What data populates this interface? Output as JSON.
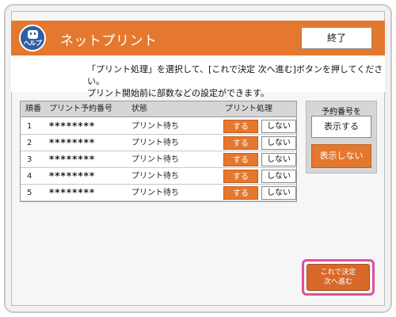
{
  "header": {
    "title": "ネットプリント",
    "help_label": "ヘルプ",
    "end_label": "終了"
  },
  "instructions": {
    "line1": "「プリント処理」を選択して、[これで決定 次へ進む]ボタンを押してください。",
    "line2": "プリント開始前に部数などの設定ができます。"
  },
  "table": {
    "headers": {
      "order": "順番",
      "reservation": "プリント予約番号",
      "status": "状態",
      "process": "プリント処理"
    },
    "rows": [
      {
        "order": "1",
        "reservation": "********",
        "status": "プリント待ち",
        "do": "する",
        "dont": "しない"
      },
      {
        "order": "2",
        "reservation": "********",
        "status": "プリント待ち",
        "do": "する",
        "dont": "しない"
      },
      {
        "order": "3",
        "reservation": "********",
        "status": "プリント待ち",
        "do": "する",
        "dont": "しない"
      },
      {
        "order": "4",
        "reservation": "********",
        "status": "プリント待ち",
        "do": "する",
        "dont": "しない"
      },
      {
        "order": "5",
        "reservation": "********",
        "status": "プリント待ち",
        "do": "する",
        "dont": "しない"
      }
    ]
  },
  "side_panel": {
    "label": "予約番号を",
    "show_label": "表示する",
    "hide_label": "表示しない"
  },
  "confirm": {
    "line1": "これで決定",
    "line2": "次へ進む"
  },
  "colors": {
    "accent": "#e4782e",
    "highlight": "#e04fa0",
    "help_icon": "#2f5ea3"
  }
}
